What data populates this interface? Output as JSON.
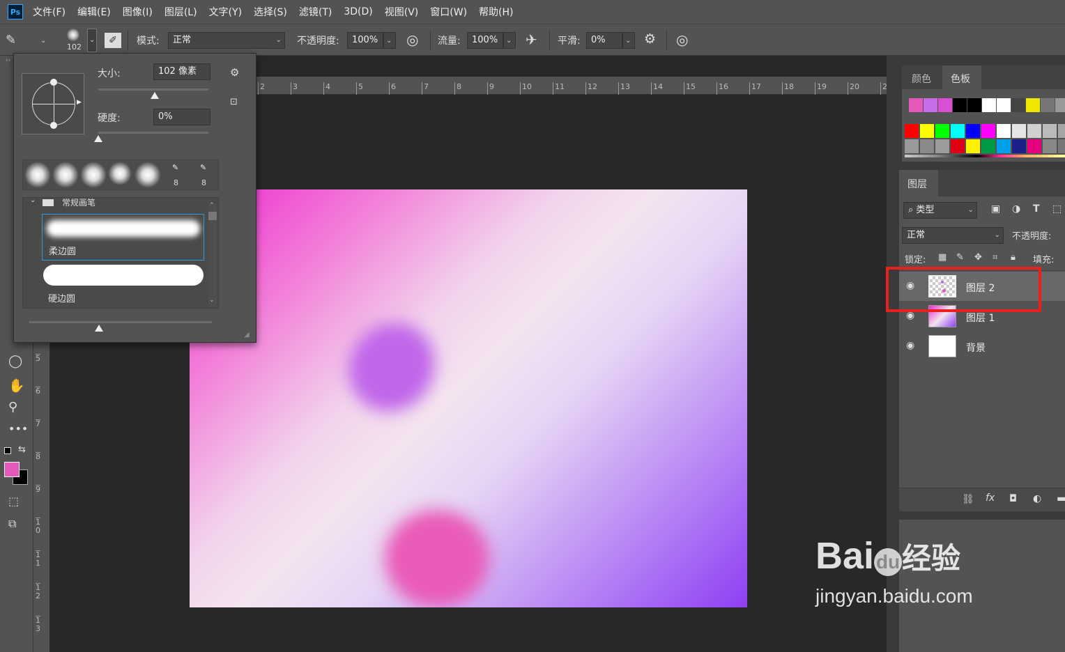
{
  "app": {
    "logo": "Ps"
  },
  "menu": [
    "文件(F)",
    "编辑(E)",
    "图像(I)",
    "图层(L)",
    "文字(Y)",
    "选择(S)",
    "滤镜(T)",
    "3D(D)",
    "视图(V)",
    "窗口(W)",
    "帮助(H)"
  ],
  "options": {
    "brush_size_badge": "102",
    "mode_label": "模式:",
    "mode_value": "正常",
    "opacity_label": "不透明度:",
    "opacity_value": "100%",
    "flow_label": "流量:",
    "flow_value": "100%",
    "smooth_label": "平滑:",
    "smooth_value": "0%"
  },
  "brush_popup": {
    "size_label": "大小:",
    "size_value": "102 像素",
    "size_fraction": 0.51,
    "hardness_label": "硬度:",
    "hardness_value": "0%",
    "hardness_fraction": 0.0,
    "recent_tip_counts": [
      "8",
      "8"
    ],
    "group_name": "常规画笔",
    "brushes": [
      "柔边圆",
      "硬边圆"
    ]
  },
  "hruler_ticks": [
    "2",
    "3",
    "4",
    "5",
    "6",
    "7",
    "8",
    "9",
    "10",
    "11",
    "12",
    "13",
    "14",
    "15",
    "16",
    "17",
    "18",
    "19",
    "20",
    "2"
  ],
  "vruler_ticks": [
    "5",
    "6",
    "7",
    "8",
    "9",
    "1\n0",
    "1\n1",
    "1\n2",
    "1\n3"
  ],
  "swatch_panel": {
    "tabs": [
      "颜色",
      "色板"
    ],
    "active_tab": "色板",
    "recent": [
      "#e35aba",
      "#c56ce6",
      "#d94ed2",
      "#000000",
      "#000000",
      "#ffffff",
      "#ffffff",
      "#444444",
      "#f0e600",
      "#777777",
      "#999999"
    ],
    "grid_row1": [
      "#ff0000",
      "#ffff00",
      "#00ff00",
      "#00ffff",
      "#0000ff",
      "#ff00ff",
      "#ffffff",
      "#e6e6e6",
      "#d0d0d0",
      "#bbbbbb",
      "#a5a5a5"
    ],
    "grid_row2": [
      "#9a9a9a",
      "#8a8a8a",
      "#9c9c9c",
      "#e00016",
      "#fff100",
      "#009944",
      "#00a0e9",
      "#1d2088",
      "#e4007f",
      "#888888",
      "#777777"
    ]
  },
  "layers_panel": {
    "tab": "图层",
    "filter_label": "类型",
    "blend_mode": "正常",
    "opacity_label": "不透明度:",
    "lock_label": "锁定:",
    "fill_label": "填充:",
    "layers": [
      {
        "name": "图层 2",
        "selected": true
      },
      {
        "name": "图层 1",
        "selected": false
      },
      {
        "name": "背景",
        "selected": false
      }
    ],
    "footer_fx": "fx"
  },
  "colors": {
    "foreground": "#e35aba",
    "background": "#000000",
    "highlight_box": "#e8211d"
  },
  "watermark": {
    "brand": "Bai",
    "brand2": "du",
    "text": "经验",
    "url": "jingyan.baidu.com"
  }
}
